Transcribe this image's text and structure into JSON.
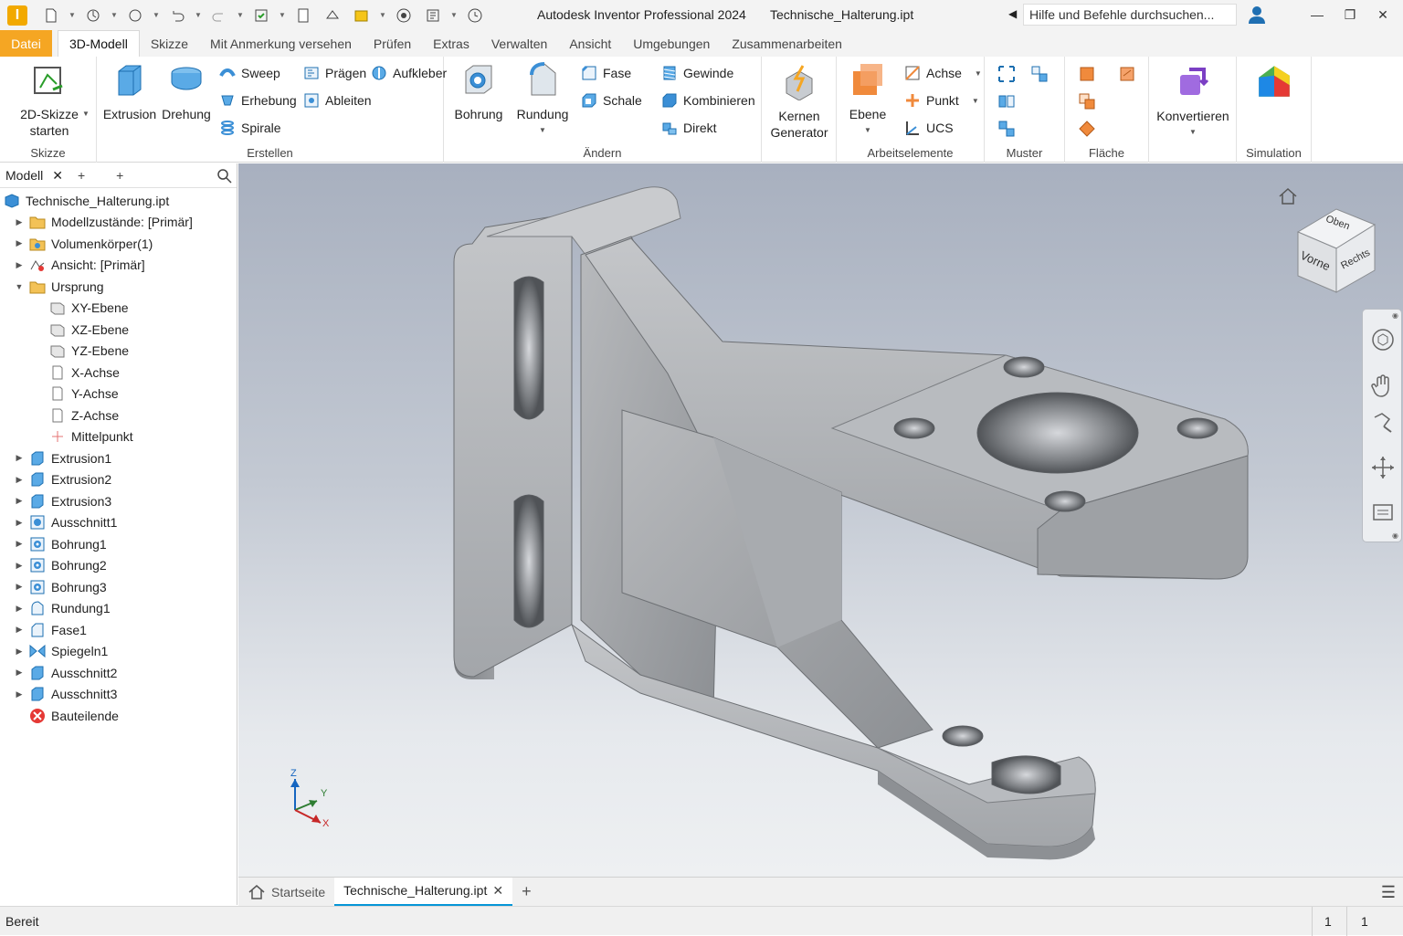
{
  "titlebar": {
    "app_logo": "I",
    "app_title": "Autodesk Inventor Professional 2024",
    "file_name": "Technische_Halterung.ipt",
    "search_placeholder": "Hilfe und Befehle durchsuchen..."
  },
  "tabs": {
    "file": "Datei",
    "items": [
      "3D-Modell",
      "Skizze",
      "Mit Anmerkung versehen",
      "Prüfen",
      "Extras",
      "Verwalten",
      "Ansicht",
      "Umgebungen",
      "Zusammenarbeiten"
    ],
    "active": "3D-Modell"
  },
  "ribbon": {
    "sketch": {
      "label_line1": "2D-Skizze",
      "label_line2": "starten",
      "panel": "Skizze"
    },
    "create": {
      "panel": "Erstellen",
      "extrusion": "Extrusion",
      "drehung": "Drehung",
      "sweep": "Sweep",
      "erhebung": "Erhebung",
      "spirale": "Spirale",
      "praegen": "Prägen",
      "ableiten": "Ableiten",
      "aufkleber": "Aufkleber"
    },
    "modify": {
      "panel": "Ändern",
      "bohrung": "Bohrung",
      "rundung": "Rundung",
      "fase": "Fase",
      "schale": "Schale",
      "gewinde": "Gewinde",
      "kombinieren": "Kombinieren",
      "direkt": "Direkt"
    },
    "generator": {
      "line1": "Kernen",
      "line2": "Generator"
    },
    "work": {
      "panel": "Arbeitselemente",
      "ebene": "Ebene",
      "achse": "Achse",
      "punkt": "Punkt",
      "ucs": "UCS"
    },
    "pattern": {
      "panel": "Muster"
    },
    "surface": {
      "panel": "Fläche"
    },
    "convert": {
      "label": "Konvertieren"
    },
    "simulation": {
      "panel": "Simulation"
    }
  },
  "browser": {
    "tab_label": "Modell",
    "tree": [
      {
        "label": "Technische_Halterung.ipt",
        "icon": "part-icon",
        "level": 0,
        "expander": ""
      },
      {
        "label": "Modellzustände: [Primär]",
        "icon": "folder-icon",
        "level": 1,
        "expander": "▶"
      },
      {
        "label": "Volumenkörper(1)",
        "icon": "solid-bodies-icon",
        "level": 1,
        "expander": "▶"
      },
      {
        "label": "Ansicht: [Primär]",
        "icon": "view-icon",
        "level": 1,
        "expander": "▶"
      },
      {
        "label": "Ursprung",
        "icon": "folder-icon",
        "level": 1,
        "expander": "▼"
      },
      {
        "label": "XY-Ebene",
        "icon": "plane-icon",
        "level": 2,
        "expander": ""
      },
      {
        "label": "XZ-Ebene",
        "icon": "plane-icon",
        "level": 2,
        "expander": ""
      },
      {
        "label": "YZ-Ebene",
        "icon": "plane-icon",
        "level": 2,
        "expander": ""
      },
      {
        "label": "X-Achse",
        "icon": "axis-icon",
        "level": 2,
        "expander": ""
      },
      {
        "label": "Y-Achse",
        "icon": "axis-icon",
        "level": 2,
        "expander": ""
      },
      {
        "label": "Z-Achse",
        "icon": "axis-icon",
        "level": 2,
        "expander": ""
      },
      {
        "label": "Mittelpunkt",
        "icon": "point-icon",
        "level": 2,
        "expander": ""
      },
      {
        "label": "Extrusion1",
        "icon": "extrude-icon",
        "level": 1,
        "expander": "▶"
      },
      {
        "label": "Extrusion2",
        "icon": "extrude-icon",
        "level": 1,
        "expander": "▶"
      },
      {
        "label": "Extrusion3",
        "icon": "extrude-icon",
        "level": 1,
        "expander": "▶"
      },
      {
        "label": "Ausschnitt1",
        "icon": "cut-icon",
        "level": 1,
        "expander": "▶"
      },
      {
        "label": "Bohrung1",
        "icon": "hole-icon",
        "level": 1,
        "expander": "▶"
      },
      {
        "label": "Bohrung2",
        "icon": "hole-icon",
        "level": 1,
        "expander": "▶"
      },
      {
        "label": "Bohrung3",
        "icon": "hole-icon",
        "level": 1,
        "expander": "▶"
      },
      {
        "label": "Rundung1",
        "icon": "fillet-icon",
        "level": 1,
        "expander": "▶"
      },
      {
        "label": "Fase1",
        "icon": "chamfer-icon",
        "level": 1,
        "expander": "▶"
      },
      {
        "label": "Spiegeln1",
        "icon": "mirror-icon",
        "level": 1,
        "expander": "▶"
      },
      {
        "label": "Ausschnitt2",
        "icon": "extrude-icon",
        "level": 1,
        "expander": "▶"
      },
      {
        "label": "Ausschnitt3",
        "icon": "extrude-icon",
        "level": 1,
        "expander": "▶"
      },
      {
        "label": "Bauteilende",
        "icon": "end-of-part-icon",
        "level": 1,
        "expander": ""
      }
    ]
  },
  "viewcube": {
    "top": "Oben",
    "front": "Vorne",
    "right": "Rechts"
  },
  "triad": {
    "x": "X",
    "y": "Y",
    "z": "Z"
  },
  "doc_tabs": {
    "home": "Startseite",
    "active": "Technische_Halterung.ipt"
  },
  "status": {
    "text": "Bereit",
    "count1": "1",
    "count2": "1"
  },
  "colors": {
    "accent": "#0696d7",
    "file_tab": "#f5a623",
    "feature_blue": "#3b8fd6",
    "ebene_orange": "#f08a3c"
  }
}
